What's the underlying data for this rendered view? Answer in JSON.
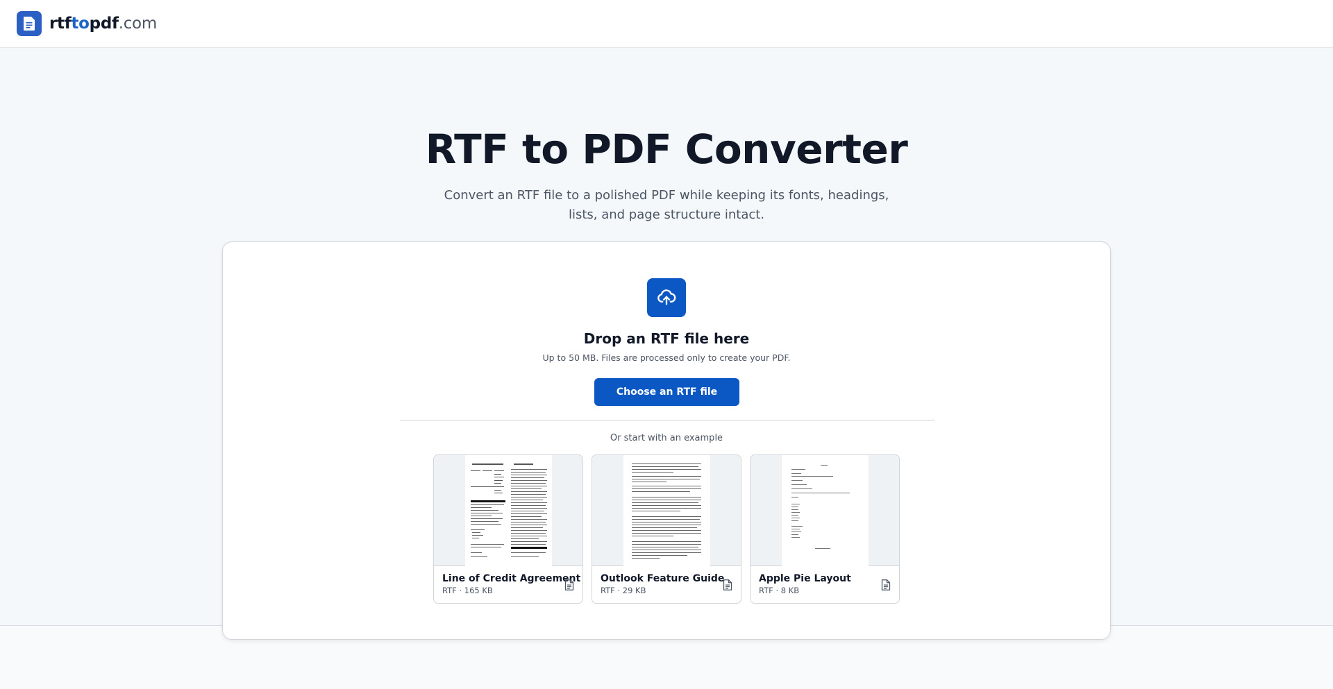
{
  "header": {
    "logo_part1": "rtf",
    "logo_part2": "to",
    "logo_part3": "pdf",
    "logo_part4": ".com",
    "logo_icon": "document-icon"
  },
  "hero": {
    "title": "RTF to PDF Converter",
    "subtitle": "Convert an RTF file to a polished PDF while keeping its fonts, headings, lists, and page structure intact."
  },
  "upload": {
    "icon": "cloud-upload-icon",
    "drop_title": "Drop an RTF file here",
    "drop_note": "Up to 50 MB. Files are processed only to create your PDF.",
    "button_label": "Choose an RTF file"
  },
  "examples": {
    "label": "Or start with an example",
    "items": [
      {
        "name": "Line of Credit Agreement",
        "meta": "RTF · 165 KB",
        "icon": "file-text-icon"
      },
      {
        "name": "Outlook Feature Guide",
        "meta": "RTF · 29 KB",
        "icon": "file-text-icon"
      },
      {
        "name": "Apple Pie Layout",
        "meta": "RTF · 8 KB",
        "icon": "file-text-icon"
      }
    ]
  },
  "colors": {
    "accent": "#0b57c4",
    "logo_blue": "#1e63c7",
    "background": "#f5f8fa"
  }
}
